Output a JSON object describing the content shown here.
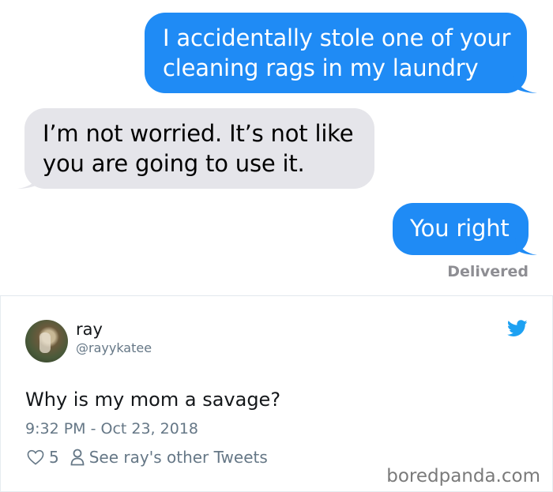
{
  "conversation": {
    "messages": [
      {
        "text": "I accidentally stole one of your\ncleaning rags in my laundry",
        "side": "sent"
      },
      {
        "text": "I’m not worried.  It’s not like\nyou are going to use it.",
        "side": "received"
      },
      {
        "text": "You right",
        "side": "sent"
      }
    ],
    "status": "Delivered"
  },
  "tweet": {
    "name": "ray",
    "handle": "@rayykatee",
    "text": "Why is my mom a savage?",
    "timestamp": "9:32 PM - Oct 23, 2018",
    "likes": "5",
    "see_other": "See ray's other Tweets"
  },
  "watermark": "boredpanda.com",
  "colors": {
    "sent_bubble": "#1f8bf5",
    "received_bubble": "#e5e5ea",
    "twitter_blue": "#1da1f2"
  },
  "icons": [
    "twitter-bird-icon",
    "heart-icon",
    "person-icon"
  ]
}
